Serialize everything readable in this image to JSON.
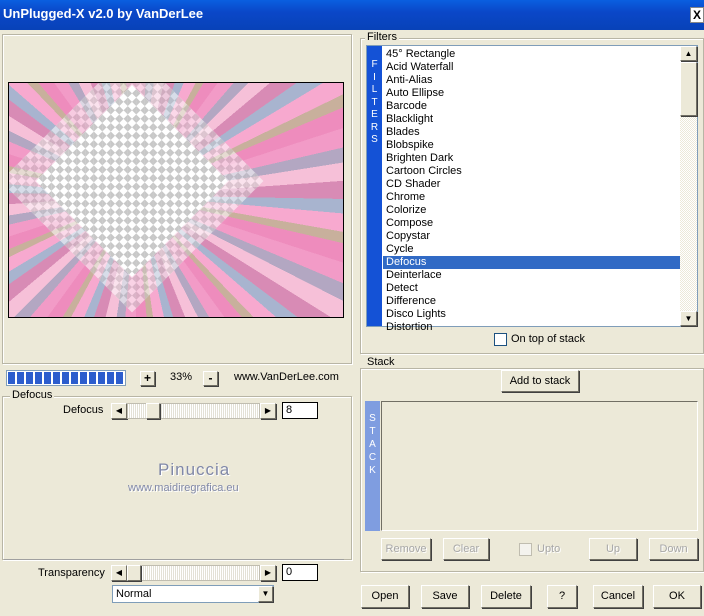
{
  "window": {
    "title": "UnPlugged-X v2.0 by VanDerLee",
    "close_glyph": "X"
  },
  "zoom": {
    "minus": "-",
    "plus": "+",
    "value": "33%",
    "progress_fraction": 1.0
  },
  "website": "www.VanDerLee.com",
  "defocus_group": {
    "label": "Defocus",
    "slider": {
      "label": "Defocus",
      "value": "8"
    }
  },
  "watermark": {
    "name": "Pinuccia",
    "url": "www.maidiregrafica.eu"
  },
  "transparency": {
    "label": "Transparency",
    "value": "0"
  },
  "blend_mode": {
    "selected": "Normal"
  },
  "filters": {
    "label": "Filters",
    "sidebar_letters": [
      "F",
      "I",
      "L",
      "T",
      "E",
      "R",
      "S"
    ],
    "items": [
      "45° Rectangle",
      "Acid Waterfall",
      "Anti-Alias",
      "Auto Ellipse",
      "Barcode",
      "Blacklight",
      "Blades",
      "Blobspike",
      "Brighten Dark",
      "Cartoon Circles",
      "CD Shader",
      "Chrome",
      "Colorize",
      "Compose",
      "Copystar",
      "Cycle",
      "Defocus",
      "Deinterlace",
      "Detect",
      "Difference",
      "Disco Lights",
      "Distortion"
    ],
    "selected": "Defocus",
    "on_top_label": "On top of stack"
  },
  "stack": {
    "label": "Stack",
    "add_label": "Add to stack",
    "sidebar_letters": [
      "S",
      "T",
      "A",
      "C",
      "K"
    ],
    "remove_label": "Remove",
    "clear_label": "Clear",
    "upto_label": "Upto",
    "up_label": "Up",
    "down_label": "Down"
  },
  "footer": {
    "open": "Open",
    "save": "Save",
    "delete": "Delete",
    "help": "?",
    "cancel": "Cancel",
    "ok": "OK"
  },
  "colors": {
    "titlebar": "#0a47c8",
    "selection": "#316ac5",
    "filter_bar": "#1452d6",
    "stack_bar": "#7f9de0",
    "face": "#ece9d8"
  }
}
